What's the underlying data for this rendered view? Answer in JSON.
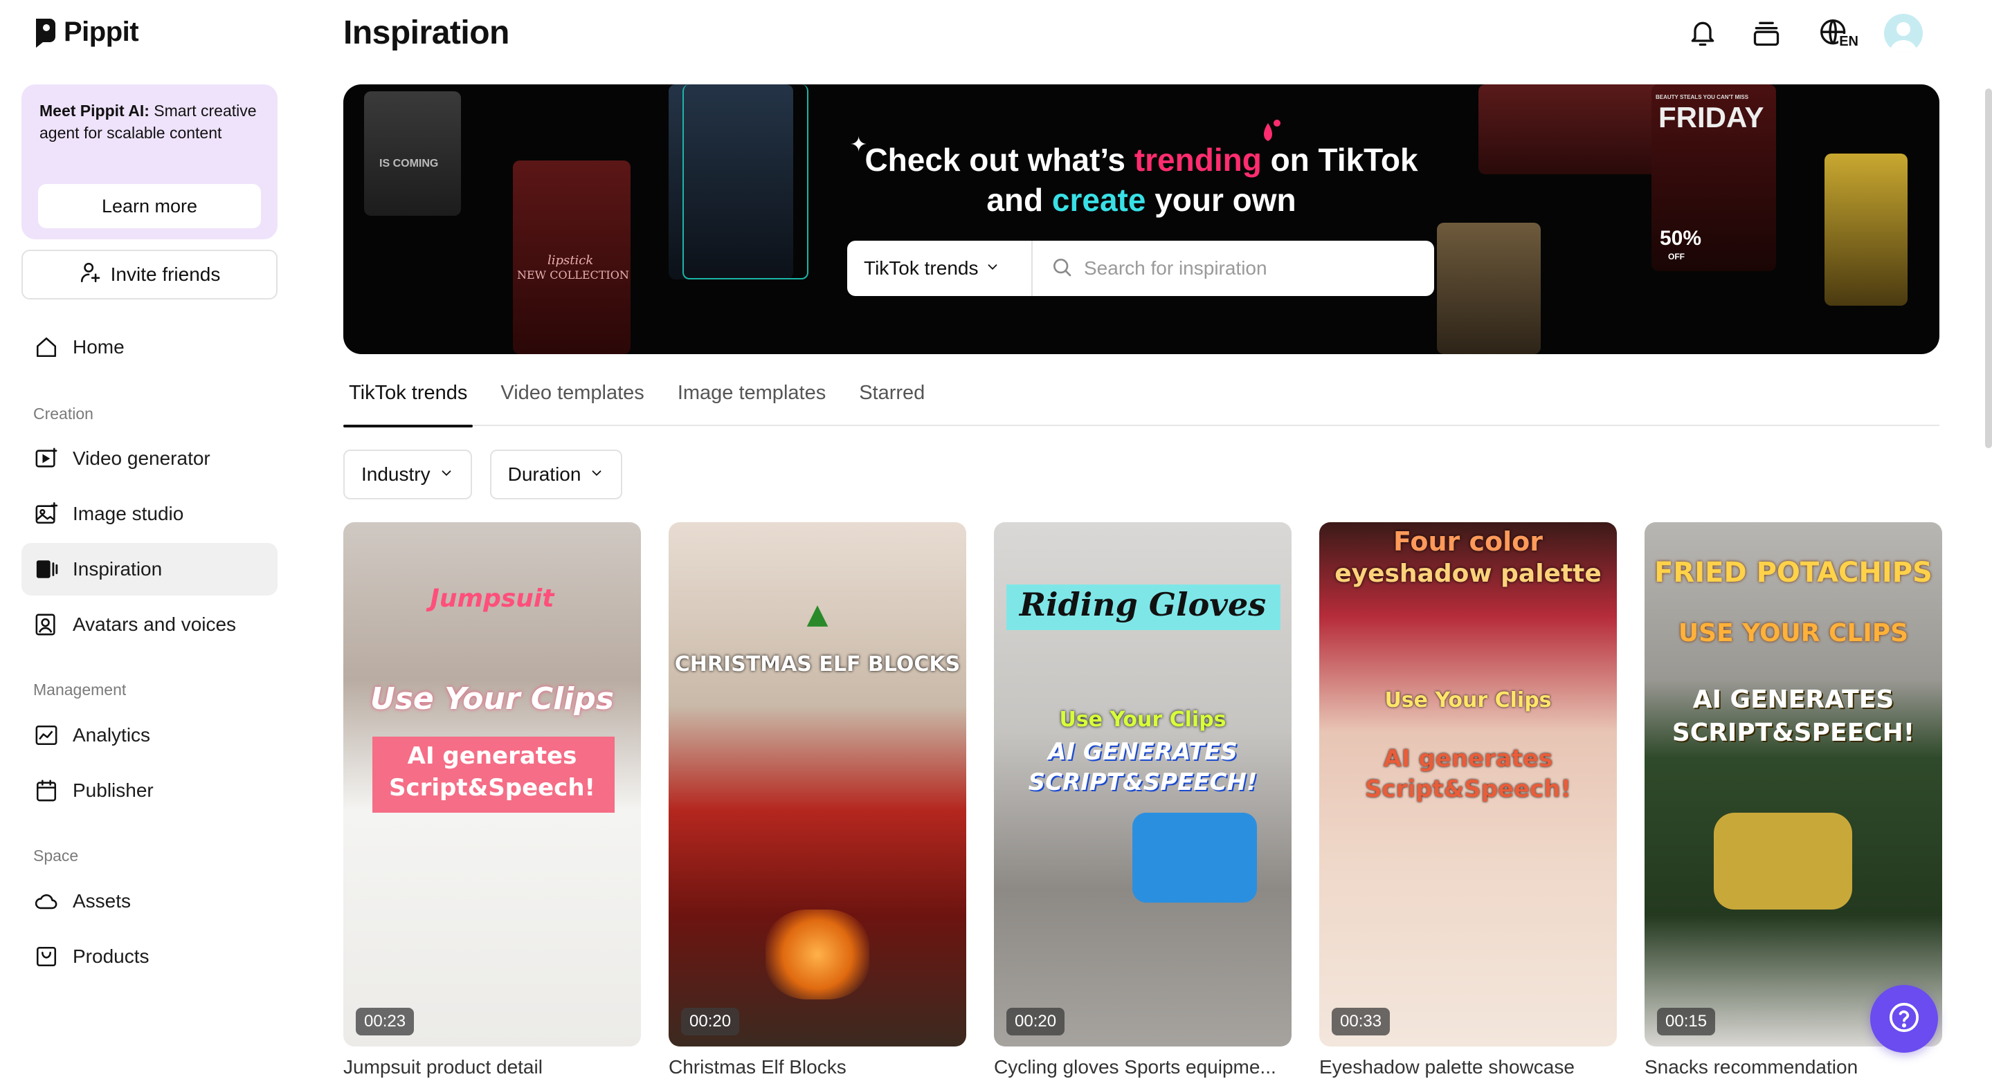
{
  "app": {
    "name": "Pippit"
  },
  "sidebar": {
    "promo": {
      "title": "Meet Pippit AI:",
      "text": " Smart creative agent for scalable content",
      "button": "Learn more"
    },
    "invite_label": "Invite friends",
    "home": "Home",
    "sections": {
      "creation": "Creation",
      "management": "Management",
      "space": "Space"
    },
    "creation_items": [
      "Video generator",
      "Image studio",
      "Inspiration",
      "Avatars and voices"
    ],
    "management_items": [
      "Analytics",
      "Publisher"
    ],
    "space_items": [
      "Assets",
      "Products"
    ],
    "active_item": "Inspiration"
  },
  "header": {
    "title": "Inspiration",
    "language": "EN"
  },
  "banner": {
    "line1_a": "Check out what’s ",
    "line1_trending": "trending",
    "line1_b": " on TikTok",
    "line2_a": "and ",
    "line2_create": "create",
    "line2_b": " your own",
    "select_label": "TikTok trends",
    "search_placeholder": "Search for inspiration",
    "thumb_texts": {
      "coming": "IS COMING",
      "lipstick_1": "lipstick",
      "lipstick_2": "NEW COLLECTION",
      "friday_small": "BEAUTY STEALS YOU CAN'T MISS",
      "friday": "FRIDAY",
      "discount": "50%",
      "off": "OFF"
    }
  },
  "tabs": [
    "TikTok trends",
    "Video templates",
    "Image templates",
    "Starred"
  ],
  "active_tab": "TikTok trends",
  "filters": [
    "Industry",
    "Duration"
  ],
  "cards": [
    {
      "title": "Jumpsuit product detail",
      "duration": "00:23",
      "overlay": [
        "Jumpsuit",
        "Use Your Clips",
        "AI generates",
        "Script&Speech!"
      ]
    },
    {
      "title": "Christmas Elf Blocks",
      "duration": "00:20",
      "overlay": [
        "CHRISTMAS ELF BLOCKS"
      ]
    },
    {
      "title": "Cycling gloves Sports equipme...",
      "duration": "00:20",
      "overlay": [
        "Riding Gloves",
        "Use Your Clips",
        "AI GENERATES",
        "SCRIPT&SPEECH!"
      ]
    },
    {
      "title": "Eyeshadow palette showcase",
      "duration": "00:33",
      "overlay": [
        "Four color",
        "eyeshadow palette",
        "Use Your Clips",
        "AI generates",
        "Script&Speech!"
      ]
    },
    {
      "title": "Snacks recommendation",
      "duration": "00:15",
      "overlay": [
        "FRIED POTACHIPS",
        "USE YOUR CLIPS",
        "AI GENERATES",
        "SCRIPT&SPEECH!"
      ]
    }
  ],
  "colors": {
    "accent_pink": "#ff2d6f",
    "accent_cyan": "#38e0e6",
    "promo_bg": "#efe3fb",
    "help_button": "#6a4cf0"
  },
  "icons": [
    "bell-icon",
    "inbox-icon",
    "globe-language-icon",
    "avatar",
    "home-icon",
    "video-generator-icon",
    "image-studio-icon",
    "inspiration-icon",
    "avatars-voices-icon",
    "analytics-icon",
    "publisher-icon",
    "assets-icon",
    "products-icon",
    "search-icon",
    "chevron-down-icon",
    "help-icon"
  ]
}
